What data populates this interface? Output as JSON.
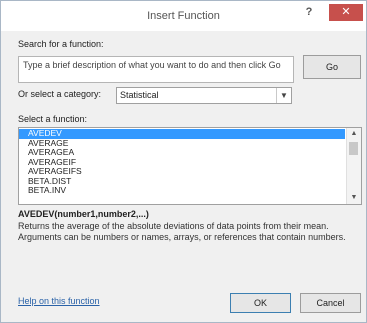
{
  "window": {
    "title": "Insert Function",
    "help_glyph": "?",
    "close_glyph": "✕"
  },
  "search": {
    "label": "Search for a function:",
    "value": "Type a brief description of what you want to do and then click Go",
    "go_label": "Go"
  },
  "category": {
    "label": "Or select a category:",
    "selected": "Statistical"
  },
  "functions": {
    "label": "Select a function:",
    "items": [
      "AVEDEV",
      "AVERAGE",
      "AVERAGEA",
      "AVERAGEIF",
      "AVERAGEIFS",
      "BETA.DIST",
      "BETA.INV"
    ],
    "selected_index": 0
  },
  "details": {
    "signature": "AVEDEV(number1,number2,...)",
    "description": "Returns the average of the absolute deviations of data points from their mean. Arguments can be numbers or names, arrays, or references that contain numbers."
  },
  "footer": {
    "help_link": "Help on this function",
    "ok_label": "OK",
    "cancel_label": "Cancel"
  },
  "colors": {
    "selection": "#3399ff",
    "close_button": "#c7504c",
    "link": "#2a62a8"
  }
}
